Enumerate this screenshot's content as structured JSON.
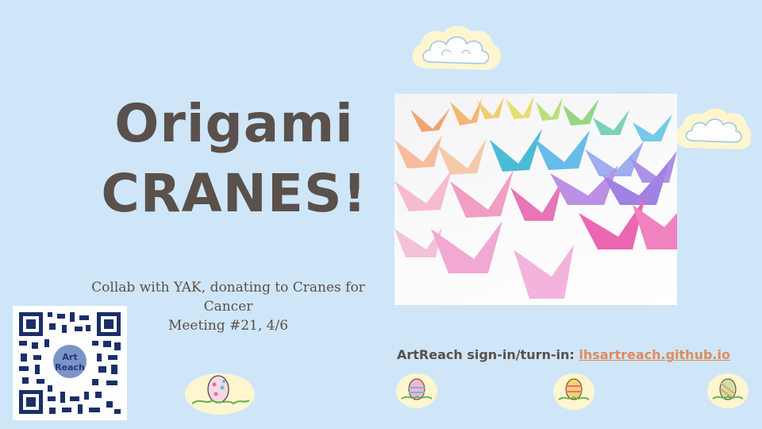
{
  "slide": {
    "title_lines": [
      "Origami",
      "CRANES!"
    ],
    "subtitle_lines": [
      "Collab with YAK, donating to Cranes for",
      "Cancer",
      "Meeting #21, 4/6"
    ],
    "signin_label": "ArtReach sign-in/turn-in:",
    "signin_link": "lhsartreach.github.io",
    "qr_logo_text": [
      "Art",
      "Reach"
    ]
  },
  "colors": {
    "background": "#cfe6f8",
    "text": "#5a504c",
    "link": "#e08a5c"
  },
  "icons": [
    "cloud-icon",
    "easter-egg-icon",
    "qr-code",
    "origami-crane-photo"
  ]
}
